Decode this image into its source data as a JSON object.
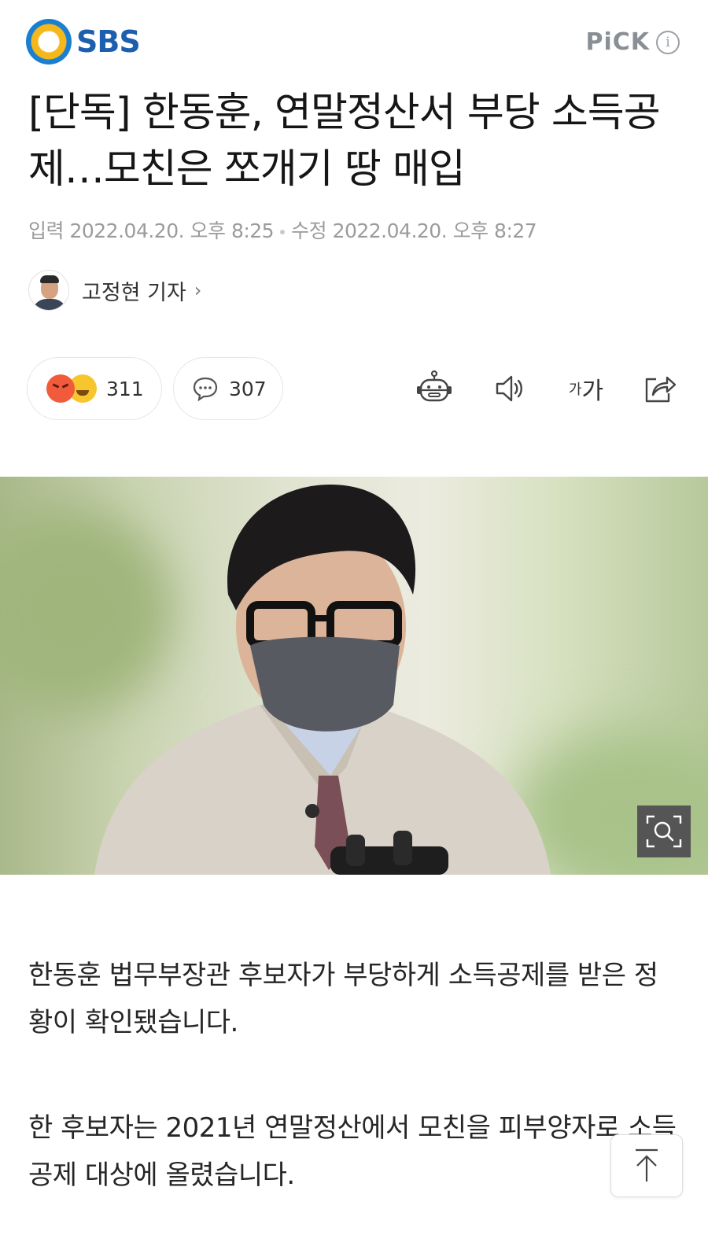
{
  "header": {
    "logo_text": "SBS",
    "pick_label": "PiCK",
    "info_icon": "i"
  },
  "article": {
    "title": "[단독] 한동훈, 연말정산서 부당 소득공제…모친은 쪼개기 땅 매입",
    "input_label": "입력",
    "input_date": "2022.04.20. 오후 8:25",
    "edit_label": "수정",
    "edit_date": "2022.04.20. 오후 8:27",
    "reporter": "고정현 기자",
    "paragraphs": [
      "한동훈 법무부장관 후보자가 부당하게 소득공제를 받은 정황이 확인됐습니다.",
      "한 후보자는 2021년 연말정산에서 모친을 피부양자로 소득공제 대상에 올렸습니다."
    ]
  },
  "actions": {
    "reaction_count": "311",
    "comment_count": "307",
    "font_label_small": "가",
    "font_label_large": "가"
  },
  "colors": {
    "brand_blue": "#1d5fae",
    "brand_yellow": "#f5b81a",
    "meta_gray": "#9b9b9b"
  }
}
